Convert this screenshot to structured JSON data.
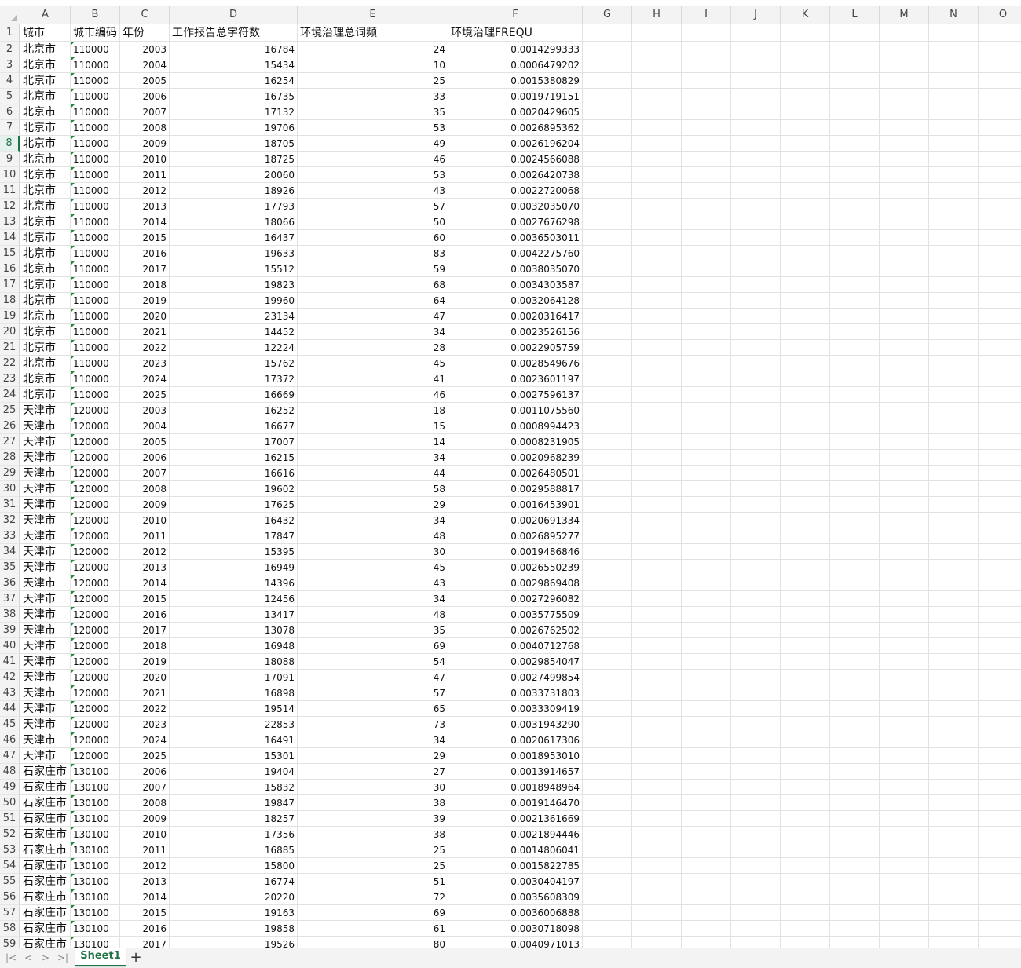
{
  "columns": [
    "A",
    "B",
    "C",
    "D",
    "E",
    "F",
    "G",
    "H",
    "I",
    "J",
    "K",
    "L",
    "M",
    "N",
    "O"
  ],
  "active_row": 8,
  "headers": {
    "a": "城市",
    "b": "城市编码",
    "c": "年份",
    "d": "工作报告总字符数",
    "e": "环境治理总词频",
    "f": "环境治理FREQU"
  },
  "rows": [
    [
      "北京市",
      "110000",
      "2003",
      "16784",
      "24",
      "0.0014299333"
    ],
    [
      "北京市",
      "110000",
      "2004",
      "15434",
      "10",
      "0.0006479202"
    ],
    [
      "北京市",
      "110000",
      "2005",
      "16254",
      "25",
      "0.0015380829"
    ],
    [
      "北京市",
      "110000",
      "2006",
      "16735",
      "33",
      "0.0019719151"
    ],
    [
      "北京市",
      "110000",
      "2007",
      "17132",
      "35",
      "0.0020429605"
    ],
    [
      "北京市",
      "110000",
      "2008",
      "19706",
      "53",
      "0.0026895362"
    ],
    [
      "北京市",
      "110000",
      "2009",
      "18705",
      "49",
      "0.0026196204"
    ],
    [
      "北京市",
      "110000",
      "2010",
      "18725",
      "46",
      "0.0024566088"
    ],
    [
      "北京市",
      "110000",
      "2011",
      "20060",
      "53",
      "0.0026420738"
    ],
    [
      "北京市",
      "110000",
      "2012",
      "18926",
      "43",
      "0.0022720068"
    ],
    [
      "北京市",
      "110000",
      "2013",
      "17793",
      "57",
      "0.0032035070"
    ],
    [
      "北京市",
      "110000",
      "2014",
      "18066",
      "50",
      "0.0027676298"
    ],
    [
      "北京市",
      "110000",
      "2015",
      "16437",
      "60",
      "0.0036503011"
    ],
    [
      "北京市",
      "110000",
      "2016",
      "19633",
      "83",
      "0.0042275760"
    ],
    [
      "北京市",
      "110000",
      "2017",
      "15512",
      "59",
      "0.0038035070"
    ],
    [
      "北京市",
      "110000",
      "2018",
      "19823",
      "68",
      "0.0034303587"
    ],
    [
      "北京市",
      "110000",
      "2019",
      "19960",
      "64",
      "0.0032064128"
    ],
    [
      "北京市",
      "110000",
      "2020",
      "23134",
      "47",
      "0.0020316417"
    ],
    [
      "北京市",
      "110000",
      "2021",
      "14452",
      "34",
      "0.0023526156"
    ],
    [
      "北京市",
      "110000",
      "2022",
      "12224",
      "28",
      "0.0022905759"
    ],
    [
      "北京市",
      "110000",
      "2023",
      "15762",
      "45",
      "0.0028549676"
    ],
    [
      "北京市",
      "110000",
      "2024",
      "17372",
      "41",
      "0.0023601197"
    ],
    [
      "北京市",
      "110000",
      "2025",
      "16669",
      "46",
      "0.0027596137"
    ],
    [
      "天津市",
      "120000",
      "2003",
      "16252",
      "18",
      "0.0011075560"
    ],
    [
      "天津市",
      "120000",
      "2004",
      "16677",
      "15",
      "0.0008994423"
    ],
    [
      "天津市",
      "120000",
      "2005",
      "17007",
      "14",
      "0.0008231905"
    ],
    [
      "天津市",
      "120000",
      "2006",
      "16215",
      "34",
      "0.0020968239"
    ],
    [
      "天津市",
      "120000",
      "2007",
      "16616",
      "44",
      "0.0026480501"
    ],
    [
      "天津市",
      "120000",
      "2008",
      "19602",
      "58",
      "0.0029588817"
    ],
    [
      "天津市",
      "120000",
      "2009",
      "17625",
      "29",
      "0.0016453901"
    ],
    [
      "天津市",
      "120000",
      "2010",
      "16432",
      "34",
      "0.0020691334"
    ],
    [
      "天津市",
      "120000",
      "2011",
      "17847",
      "48",
      "0.0026895277"
    ],
    [
      "天津市",
      "120000",
      "2012",
      "15395",
      "30",
      "0.0019486846"
    ],
    [
      "天津市",
      "120000",
      "2013",
      "16949",
      "45",
      "0.0026550239"
    ],
    [
      "天津市",
      "120000",
      "2014",
      "14396",
      "43",
      "0.0029869408"
    ],
    [
      "天津市",
      "120000",
      "2015",
      "12456",
      "34",
      "0.0027296082"
    ],
    [
      "天津市",
      "120000",
      "2016",
      "13417",
      "48",
      "0.0035775509"
    ],
    [
      "天津市",
      "120000",
      "2017",
      "13078",
      "35",
      "0.0026762502"
    ],
    [
      "天津市",
      "120000",
      "2018",
      "16948",
      "69",
      "0.0040712768"
    ],
    [
      "天津市",
      "120000",
      "2019",
      "18088",
      "54",
      "0.0029854047"
    ],
    [
      "天津市",
      "120000",
      "2020",
      "17091",
      "47",
      "0.0027499854"
    ],
    [
      "天津市",
      "120000",
      "2021",
      "16898",
      "57",
      "0.0033731803"
    ],
    [
      "天津市",
      "120000",
      "2022",
      "19514",
      "65",
      "0.0033309419"
    ],
    [
      "天津市",
      "120000",
      "2023",
      "22853",
      "73",
      "0.0031943290"
    ],
    [
      "天津市",
      "120000",
      "2024",
      "16491",
      "34",
      "0.0020617306"
    ],
    [
      "天津市",
      "120000",
      "2025",
      "15301",
      "29",
      "0.0018953010"
    ],
    [
      "石家庄市",
      "130100",
      "2006",
      "19404",
      "27",
      "0.0013914657"
    ],
    [
      "石家庄市",
      "130100",
      "2007",
      "15832",
      "30",
      "0.0018948964"
    ],
    [
      "石家庄市",
      "130100",
      "2008",
      "19847",
      "38",
      "0.0019146470"
    ],
    [
      "石家庄市",
      "130100",
      "2009",
      "18257",
      "39",
      "0.0021361669"
    ],
    [
      "石家庄市",
      "130100",
      "2010",
      "17356",
      "38",
      "0.0021894446"
    ],
    [
      "石家庄市",
      "130100",
      "2011",
      "16885",
      "25",
      "0.0014806041"
    ],
    [
      "石家庄市",
      "130100",
      "2012",
      "15800",
      "25",
      "0.0015822785"
    ],
    [
      "石家庄市",
      "130100",
      "2013",
      "16774",
      "51",
      "0.0030404197"
    ],
    [
      "石家庄市",
      "130100",
      "2014",
      "20220",
      "72",
      "0.0035608309"
    ],
    [
      "石家庄市",
      "130100",
      "2015",
      "19163",
      "69",
      "0.0036006888"
    ],
    [
      "石家庄市",
      "130100",
      "2016",
      "19858",
      "61",
      "0.0030718098"
    ],
    [
      "石家庄市",
      "130100",
      "2017",
      "19526",
      "80",
      "0.0040971013"
    ]
  ],
  "tabbar": {
    "nav": [
      "|<",
      "<",
      ">",
      ">|"
    ],
    "sheet_name": "Sheet1",
    "add": "+"
  }
}
